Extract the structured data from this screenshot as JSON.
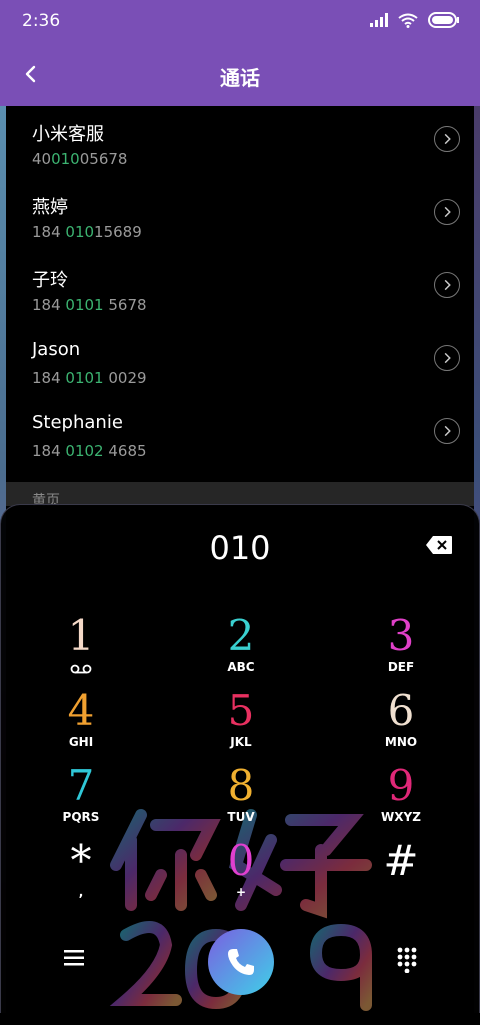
{
  "status": {
    "time": "2:36",
    "icons": [
      "signal-icon",
      "wifi-icon",
      "battery-icon"
    ]
  },
  "appbar": {
    "title": "通话",
    "back_icon": "back-arrow-icon"
  },
  "contacts": [
    {
      "name": "小米客服",
      "num_pre": "40",
      "num_hl": "010",
      "num_post": "05678"
    },
    {
      "name": "燕婷",
      "num_pre": "184 ",
      "num_hl": "010",
      "num_post": "15689"
    },
    {
      "name": "子玲",
      "num_pre": "184 ",
      "num_hl": "0101",
      "num_post": " 5678"
    },
    {
      "name": "Jason",
      "num_pre": "184 ",
      "num_hl": "0101",
      "num_post": " 0029"
    },
    {
      "name": "Stephanie",
      "num_pre": "184 ",
      "num_hl": "0102",
      "num_post": " 4685"
    }
  ],
  "section_header": "黄页",
  "dialer": {
    "entered": "010",
    "keys": [
      {
        "digit": "1",
        "letters": "",
        "color": "#f4d9c8"
      },
      {
        "digit": "2",
        "letters": "ABC",
        "color": "#3ad0d0"
      },
      {
        "digit": "3",
        "letters": "DEF",
        "color": "#e040c8"
      },
      {
        "digit": "4",
        "letters": "GHI",
        "color": "#f0a030"
      },
      {
        "digit": "5",
        "letters": "JKL",
        "color": "#e83060"
      },
      {
        "digit": "6",
        "letters": "MNO",
        "color": "#f0e0d0"
      },
      {
        "digit": "7",
        "letters": "PQRS",
        "color": "#30c8d8"
      },
      {
        "digit": "8",
        "letters": "TUV",
        "color": "#f0b030"
      },
      {
        "digit": "9",
        "letters": "WXYZ",
        "color": "#e02878"
      },
      {
        "digit": "*",
        "letters": ",",
        "color": "#ffffff"
      },
      {
        "digit": "0",
        "letters": "+",
        "color": "#e040d0"
      },
      {
        "digit": "#",
        "letters": "",
        "color": "#ffffff"
      }
    ],
    "bottom": {
      "menu_icon": "menu-icon",
      "call_icon": "phone-icon",
      "keypad_icon": "keypad-icon"
    }
  },
  "decor": {
    "greeting": "你好",
    "year": "2019"
  }
}
